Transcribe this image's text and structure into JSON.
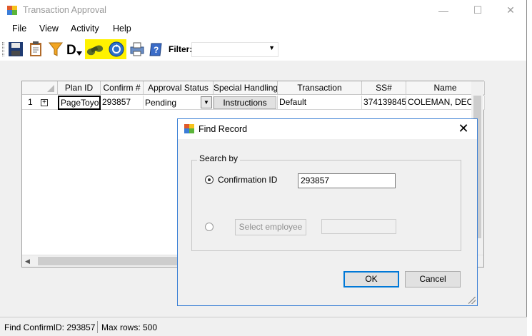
{
  "window": {
    "title": "Transaction Approval",
    "controls": {
      "minimize": "—",
      "maximize": "☐",
      "close": "✕"
    }
  },
  "menu": {
    "items": [
      "File",
      "View",
      "Activity",
      "Help"
    ]
  },
  "toolbar": {
    "icons": [
      "save-icon",
      "clipboard-icon",
      "filter-funnel-icon",
      "letter-d-icon",
      "binoculars-icon",
      "refresh-globe-icon",
      "print-icon",
      "help-book-icon"
    ],
    "filter_label": "Filter:",
    "filter_value": "",
    "highlight_color": "#fff200"
  },
  "grid": {
    "columns": [
      "Plan ID",
      "Confirm #",
      "Approval Status",
      "Special Handling",
      "Transaction",
      "SS#",
      "Name"
    ],
    "rows": [
      {
        "row_num": "1",
        "expand": "+",
        "plan_id": "PageToyota",
        "confirm": "293857",
        "status": "Pending",
        "special_handling": "Instructions",
        "transaction": "Default",
        "ss": "374139845",
        "name": "COLEMAN, DEON"
      }
    ]
  },
  "status_bar": {
    "find_text": "Find ConfirmID: 293857",
    "max_rows": "Max rows: 500"
  },
  "dialog": {
    "title": "Find Record",
    "group_label": "Search by",
    "option1_label": "Confirmation ID",
    "option1_value": "293857",
    "option2_button": "Select employee",
    "option2_value": "",
    "ok_label": "OK",
    "cancel_label": "Cancel",
    "close": "✕"
  }
}
